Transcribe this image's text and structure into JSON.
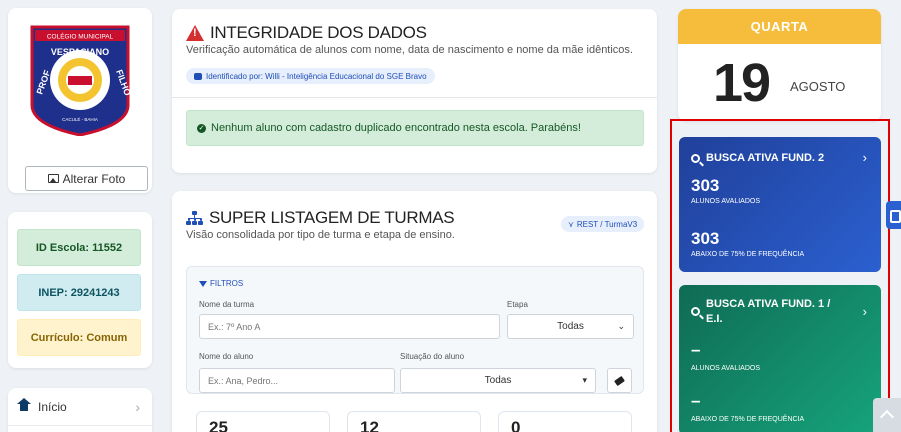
{
  "school": {
    "logo_text": {
      "top": "COLÉGIO MUNICIPAL",
      "arc": "VESPASIANO",
      "left": "PROF",
      "right": "FILHO",
      "bottom": "CACULÉ - BAHIA"
    },
    "alter_photo_label": "Alterar Foto",
    "id_label": "ID Escola: 11552",
    "inep_label": "INEP: 29241243",
    "curriculo_label": "Currículo: Comum"
  },
  "nav": {
    "items": [
      {
        "label": "Início",
        "icon": "home-icon"
      }
    ]
  },
  "integrity": {
    "title": "INTEGRIDADE DOS DADOS",
    "subtitle": "Verificação automática de alunos com nome, data de nascimento e nome da mãe idênticos.",
    "tag": "Identificado por: Willi - Inteligência Educacional do SGE Bravo",
    "success": "Nenhum aluno com cadastro duplicado encontrado nesta escola. Parabéns!"
  },
  "listing": {
    "title": "SUPER LISTAGEM DE TURMAS",
    "subtitle": "Visão consolidada por tipo de turma e etapa de ensino.",
    "badge": "REST / TurmaV3",
    "filters": {
      "heading": "FILTROS",
      "class_name_label": "Nome da turma",
      "class_name_placeholder": "Ex.: 7º Ano A",
      "stage_label": "Etapa",
      "stage_value": "Todas",
      "student_label": "Nome do aluno",
      "student_placeholder": "Ex.: Ana, Pedro...",
      "status_label": "Situação do aluno",
      "status_value": "Todas"
    },
    "stats": [
      "25",
      "12",
      "0"
    ]
  },
  "calendar": {
    "weekday": "QUARTA",
    "day": "19",
    "month": "AGOSTO"
  },
  "busca_ativa": [
    {
      "title": "BUSCA ATIVA FUND. 2",
      "students_value": "303",
      "students_label": "ALUNOS AVALIADOS",
      "below_value": "303",
      "below_label": "ABAIXO DE 75% DE FREQUÊNCIA",
      "color": "#2b60d0"
    },
    {
      "title_line1": "BUSCA ATIVA FUND. 1 /",
      "title_line2": "E.I.",
      "students_value": "–",
      "students_label": "ALUNOS AVALIADOS",
      "below_value": "–",
      "below_label": "ABAIXO DE 75% DE FREQUÊNCIA",
      "color": "#16a47b"
    }
  ],
  "colors": {
    "calendar_header": "#f6bd3d",
    "highlight_border": "#e00000",
    "primary": "#1e4fb8"
  }
}
